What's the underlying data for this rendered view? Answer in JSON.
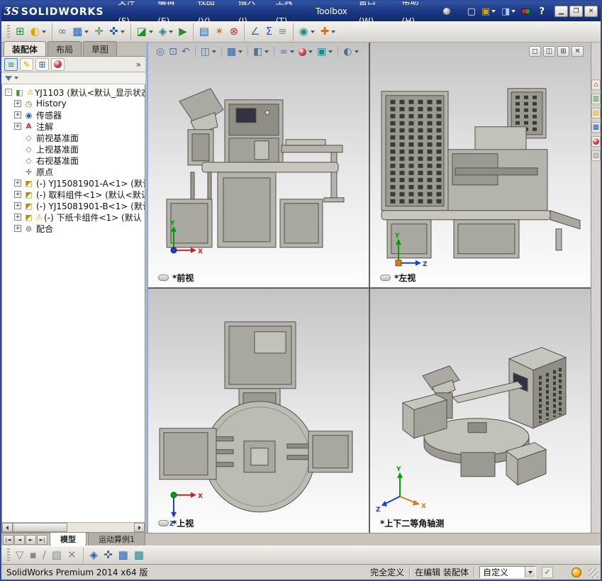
{
  "titlebar": {
    "logo": "ƷS",
    "app_name": "SOLIDWORKS",
    "menus": [
      "文件(F)",
      "编辑(E)",
      "视图(V)",
      "插入(I)",
      "工具(T)",
      "Toolbox",
      "窗口(W)",
      "帮助(H)"
    ],
    "quick_icons": [
      {
        "name": "new-document-icon",
        "glyph": "▢",
        "c": "white",
        "dd": false
      },
      {
        "name": "open-document-icon",
        "glyph": "▣",
        "c": "yellow",
        "dd": true
      },
      {
        "name": "save-icon",
        "glyph": "◨",
        "c": "lightblue",
        "dd": true
      },
      {
        "name": "performance-status-icon",
        "glyph": "",
        "c": "redgreen",
        "dd": false
      }
    ],
    "help_label": "?",
    "window_buttons": [
      {
        "name": "minimize-button",
        "glyph": "▁"
      },
      {
        "name": "maximize-button",
        "glyph": "❐"
      },
      {
        "name": "close-button",
        "glyph": "✕"
      }
    ]
  },
  "main_toolbar": {
    "icons": [
      {
        "name": "insert-components",
        "glyph": "⊞",
        "c": "green",
        "dd": false,
        "sep": false
      },
      {
        "name": "hide-show-components",
        "glyph": "◐",
        "c": "yellow",
        "dd": true,
        "sep": false
      },
      {
        "name": "mate",
        "glyph": "∞",
        "c": "steel",
        "dd": false,
        "sep": true
      },
      {
        "name": "linear-component-pattern",
        "glyph": "▦",
        "c": "blue",
        "dd": true,
        "sep": false
      },
      {
        "name": "smart-fasteners",
        "glyph": "✛",
        "c": "green",
        "dd": false,
        "sep": false
      },
      {
        "name": "move-component",
        "glyph": "✜",
        "c": "blue",
        "dd": true,
        "sep": false
      },
      {
        "name": "assembly-features",
        "glyph": "◪",
        "c": "green",
        "dd": true,
        "sep": true
      },
      {
        "name": "reference-geometry",
        "glyph": "◈",
        "c": "teal",
        "dd": true,
        "sep": false
      },
      {
        "name": "new-motion-study",
        "glyph": "▶",
        "c": "green",
        "dd": false,
        "sep": false
      },
      {
        "name": "bill-of-materials",
        "glyph": "▤",
        "c": "blue",
        "dd": false,
        "sep": true
      },
      {
        "name": "exploded-view",
        "glyph": "✶",
        "c": "orange",
        "dd": false,
        "sep": false
      },
      {
        "name": "interference-detection",
        "glyph": "⊗",
        "c": "red",
        "dd": false,
        "sep": false
      },
      {
        "name": "measure",
        "glyph": "∠",
        "c": "steel",
        "dd": false,
        "sep": true
      },
      {
        "name": "mass-properties",
        "glyph": "Σ",
        "c": "blue",
        "dd": false,
        "sep": false
      },
      {
        "name": "equations",
        "glyph": "≡",
        "c": "gray",
        "dd": false,
        "sep": false
      },
      {
        "name": "simulation-advisor",
        "glyph": "◉",
        "c": "teal",
        "dd": true,
        "sep": true
      },
      {
        "name": "options",
        "glyph": "✚",
        "c": "orange",
        "dd": true,
        "sep": false
      }
    ]
  },
  "left_panel": {
    "tabs": [
      {
        "label": "装配体",
        "active": true
      },
      {
        "label": "布局",
        "active": false
      },
      {
        "label": "草图",
        "active": false
      }
    ],
    "manager_tabs": [
      {
        "name": "featuremanager-tree-tab",
        "glyph": "≡",
        "c": "green",
        "active": true
      },
      {
        "name": "propertymanager-tab",
        "glyph": "✎",
        "c": "yellow",
        "active": false
      },
      {
        "name": "configurationmanager-tab",
        "glyph": "⊞",
        "c": "blue",
        "active": false
      },
      {
        "name": "displaymanager-tab",
        "glyph": "",
        "c": "ball",
        "active": false
      }
    ],
    "overflow_label": "»",
    "tree": [
      {
        "label": "YJ1103 (默认<默认_显示状态",
        "icon": "assembly",
        "warning": true,
        "exp": "-",
        "lvl": 0
      },
      {
        "label": "History",
        "icon": "history",
        "warning": false,
        "exp": "+",
        "lvl": 1
      },
      {
        "label": "传感器",
        "icon": "sensors",
        "warning": false,
        "exp": "+",
        "lvl": 1
      },
      {
        "label": "注解",
        "icon": "ann",
        "warning": false,
        "exp": "+",
        "lvl": 1
      },
      {
        "label": "前视基准面",
        "icon": "plane",
        "warning": false,
        "exp": "",
        "lvl": 1
      },
      {
        "label": "上视基准面",
        "icon": "plane",
        "warning": false,
        "exp": "",
        "lvl": 1
      },
      {
        "label": "右视基准面",
        "icon": "plane",
        "warning": false,
        "exp": "",
        "lvl": 1
      },
      {
        "label": "原点",
        "icon": "origin",
        "warning": false,
        "exp": "",
        "lvl": 1
      },
      {
        "label": "(-) YJ15081901-A<1> (默认",
        "icon": "part",
        "warning": false,
        "exp": "+",
        "lvl": 1
      },
      {
        "label": "(-) 取料组件<1> (默认<默认",
        "icon": "part",
        "warning": false,
        "exp": "+",
        "lvl": 1
      },
      {
        "label": "(-) YJ15081901-B<1> (默认",
        "icon": "part",
        "warning": false,
        "exp": "+",
        "lvl": 1
      },
      {
        "label": "(-) 下纸卡组件<1> (默认",
        "icon": "part",
        "warning": true,
        "exp": "+",
        "lvl": 1
      },
      {
        "label": "配合",
        "icon": "mates",
        "warning": false,
        "exp": "+",
        "lvl": 1
      }
    ]
  },
  "viewport": {
    "hud_icons": [
      {
        "name": "zoom-fit",
        "glyph": "◎",
        "c": "steel",
        "dd": false,
        "sep": false
      },
      {
        "name": "zoom-to-area",
        "glyph": "⊡",
        "c": "steel",
        "dd": false,
        "sep": false
      },
      {
        "name": "previous-view",
        "glyph": "↶",
        "c": "steel",
        "dd": false,
        "sep": false
      },
      {
        "name": "section-view",
        "glyph": "◫",
        "c": "steel",
        "dd": true,
        "sep": true
      },
      {
        "name": "view-orientation",
        "glyph": "▦",
        "c": "blue",
        "dd": true,
        "sep": true
      },
      {
        "name": "display-style",
        "glyph": "◧",
        "c": "steel",
        "dd": true,
        "sep": true
      },
      {
        "name": "hide-show-items",
        "glyph": "∞",
        "c": "steel",
        "dd": true,
        "sep": true
      },
      {
        "name": "edit-appearance",
        "glyph": "",
        "c": "ball",
        "dd": true,
        "sep": false
      },
      {
        "name": "apply-scene",
        "glyph": "▣",
        "c": "teal",
        "dd": true,
        "sep": false
      },
      {
        "name": "view-settings",
        "glyph": "◐",
        "c": "steel",
        "dd": true,
        "sep": true
      }
    ],
    "corner_buttons": [
      {
        "name": "viewport-single-button",
        "glyph": "◻"
      },
      {
        "name": "viewport-two-button",
        "glyph": "◫"
      },
      {
        "name": "viewport-four-button",
        "glyph": "⊞"
      },
      {
        "name": "viewport-close-button",
        "glyph": "✕"
      }
    ],
    "views": [
      {
        "label": "*前视"
      },
      {
        "label": "*左视"
      },
      {
        "label": "*上视"
      },
      {
        "label": "*上下二等角轴测"
      }
    ],
    "triad_axis_colors": {
      "x": "#cc2020",
      "y": "#00a000",
      "z": "#2040cc"
    }
  },
  "task_pane": {
    "icons": [
      {
        "name": "solidworks-resources-icon",
        "glyph": "⌂",
        "c": "orange"
      },
      {
        "name": "design-library-icon",
        "glyph": "▥",
        "c": "green"
      },
      {
        "name": "file-explorer-icon",
        "glyph": "▤",
        "c": "yellow"
      },
      {
        "name": "view-palette-icon",
        "glyph": "▦",
        "c": "blue"
      },
      {
        "name": "appearances-scenes-icon",
        "glyph": "",
        "c": "ball"
      },
      {
        "name": "custom-properties-icon",
        "glyph": "▧",
        "c": "gray"
      }
    ]
  },
  "model_tabs": {
    "nav": [
      {
        "name": "first-tab-button",
        "glyph": "|◄"
      },
      {
        "name": "prev-tab-button",
        "glyph": "◄"
      },
      {
        "name": "next-tab-button",
        "glyph": "►"
      },
      {
        "name": "last-tab-button",
        "glyph": "►|"
      }
    ],
    "tabs": [
      {
        "label": "模型",
        "active": true
      },
      {
        "label": "运动算例1",
        "active": false
      }
    ]
  },
  "bottom_toolbar": {
    "icons": [
      {
        "name": "selection-filter-toggle",
        "glyph": "▽",
        "c": "gray",
        "disabled": true,
        "sep": false
      },
      {
        "name": "filter-vertices",
        "glyph": "▪",
        "c": "gray",
        "disabled": true,
        "sep": false
      },
      {
        "name": "filter-edges",
        "glyph": "∕",
        "c": "gray",
        "disabled": true,
        "sep": false
      },
      {
        "name": "filter-faces",
        "glyph": "▧",
        "c": "gray",
        "disabled": true,
        "sep": false
      },
      {
        "name": "clear-all-filters",
        "glyph": "✕",
        "c": "gray",
        "disabled": true,
        "sep": false
      },
      {
        "name": "quick-snaps",
        "glyph": "◈",
        "c": "blue",
        "disabled": false,
        "sep": true
      },
      {
        "name": "snap-to-points",
        "glyph": "✜",
        "c": "steel",
        "disabled": false,
        "sep": false
      },
      {
        "name": "snap-to-grid",
        "glyph": "▦",
        "c": "blue",
        "disabled": false,
        "sep": false
      },
      {
        "name": "grid-settings",
        "glyph": "▩",
        "c": "teal",
        "disabled": false,
        "sep": false
      }
    ]
  },
  "statusbar": {
    "product": "SolidWorks Premium 2014 x64 版",
    "definition_status": "完全定义",
    "edit_status": "在编辑 装配体",
    "units": "自定义"
  }
}
